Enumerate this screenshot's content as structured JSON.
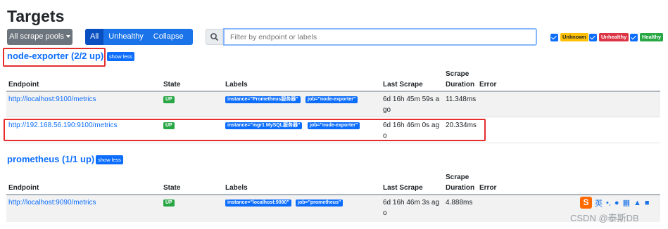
{
  "page": {
    "title": "Targets"
  },
  "toolbar": {
    "pools_label": "All scrape pools",
    "filter_all": "All",
    "filter_unhealthy": "Unhealthy",
    "collapse_all": "Collapse All",
    "search_placeholder": "Filter by endpoint or labels",
    "state_filters": [
      "Unknown",
      "Unhealthy",
      "Healthy"
    ]
  },
  "columns": {
    "endpoint": "Endpoint",
    "state": "State",
    "labels": "Labels",
    "last_scrape": "Last Scrape",
    "scrape_duration_1": "Scrape",
    "scrape_duration_2": "Duration",
    "error": "Error"
  },
  "pools": [
    {
      "title": "node-exporter (2/2 up)",
      "toggle": "show less",
      "rows": [
        {
          "endpoint": "http://localhost:9100/metrics",
          "state": "UP",
          "labels": [
            "instance=\"Prometheus服务器\"",
            "job=\"node-exporter\""
          ],
          "last_scrape_1": "6d 16h 45m 59s a",
          "last_scrape_2": "go",
          "duration": "11.348ms"
        },
        {
          "endpoint": "http://192.168.56.190:9100/metrics",
          "state": "UP",
          "labels": [
            "instance=\"mgr1 MySQL服务器\"",
            "job=\"node-exporter\""
          ],
          "last_scrape_1": "6d 16h 46m 0s ag",
          "last_scrape_2": "o",
          "duration": "20.334ms"
        }
      ]
    },
    {
      "title": "prometheus (1/1 up)",
      "toggle": "show less",
      "rows": [
        {
          "endpoint": "http://localhost:9090/metrics",
          "state": "UP",
          "labels": [
            "instance=\"localhost:9090\"",
            "job=\"prometheus\""
          ],
          "last_scrape_1": "6d 16h 46m 3s ag",
          "last_scrape_2": "o",
          "duration": "4.888ms"
        }
      ]
    }
  ],
  "ime": {
    "logo": "S",
    "lang": "英"
  },
  "watermark": "CSDN @泰斯DB"
}
